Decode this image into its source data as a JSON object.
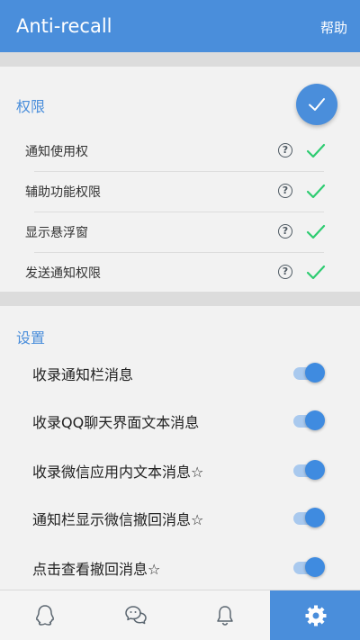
{
  "app": {
    "title": "Anti-recall",
    "help": "帮助"
  },
  "permissions": {
    "title": "权限",
    "items": [
      {
        "label": "通知使用权"
      },
      {
        "label": "辅助功能权限"
      },
      {
        "label": "显示悬浮窗"
      },
      {
        "label": "发送通知权限"
      }
    ]
  },
  "settings": {
    "title": "设置",
    "items": [
      {
        "label": "收录通知栏消息",
        "on": true
      },
      {
        "label": "收录QQ聊天界面文本消息",
        "on": true
      },
      {
        "label": "收录微信应用内文本消息☆",
        "on": true
      },
      {
        "label": "通知栏显示微信撤回消息☆",
        "on": true
      },
      {
        "label": "点击查看撤回消息☆",
        "on": true
      }
    ]
  },
  "colors": {
    "accent": "#4a8edb",
    "check": "#2ecc71"
  },
  "bottom_nav": [
    {
      "icon": "qq-icon",
      "active": false
    },
    {
      "icon": "wechat-icon",
      "active": false
    },
    {
      "icon": "bell-icon",
      "active": false
    },
    {
      "icon": "gear-icon",
      "active": true
    }
  ]
}
